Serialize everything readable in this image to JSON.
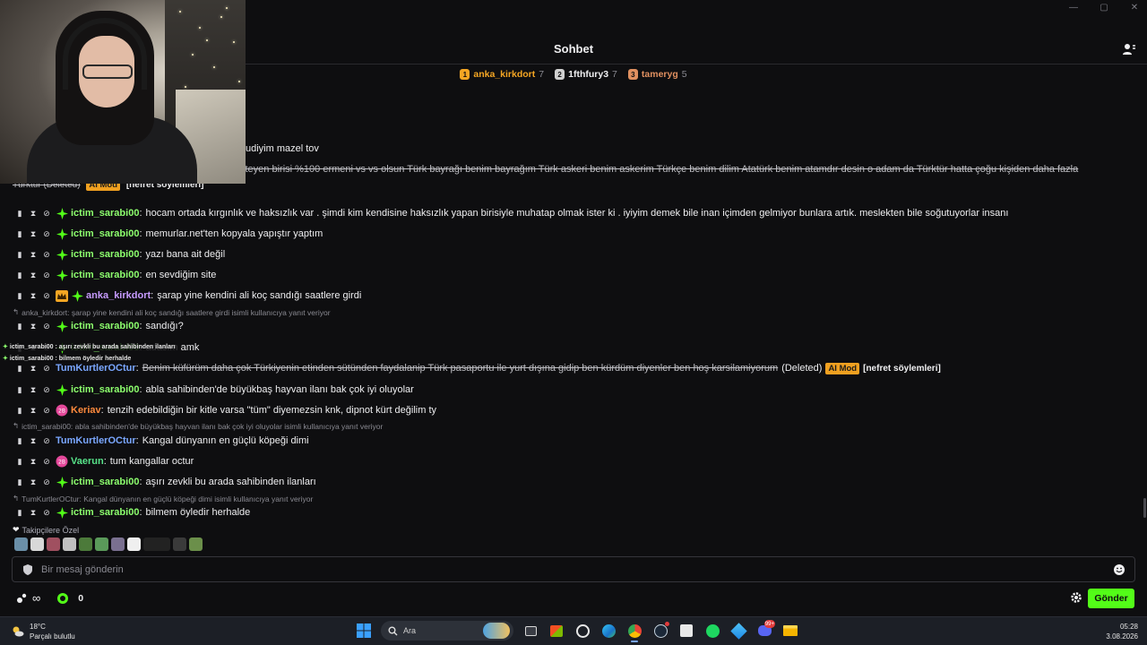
{
  "window": {
    "controls": [
      "—",
      "▢",
      "✕"
    ]
  },
  "chat": {
    "title": "Sohbet",
    "leaderboard": [
      {
        "name": "anka_kirkdort",
        "score": "7",
        "color": "#f5a623",
        "badge": "1"
      },
      {
        "name": "1fthfury3",
        "score": "7",
        "color": "#d0d0d0",
        "badge": "2"
      },
      {
        "name": "tameryg",
        "score": "5",
        "color": "#e09060",
        "badge": "3"
      }
    ],
    "partial_lines": {
      "line1": "udiyim mazel tov",
      "line2": "steyen birisi %100 ermeni vs vs olsun Türk bayrağı benim bayrağım Türk askeri benim askerim Türkçe benim dilim Atatürk benim atamdır desin o adam da Türktür hatta çoğu kişiden daha fazla",
      "line3_text": "Türktür (Deleted)",
      "line3_aimod": "AI Mod",
      "line3_reason": "[nefret söylemleri]"
    },
    "messages": [
      {
        "user": "ictim_sarabi00",
        "color": "#8dff6e",
        "text": "hocam ortada kırgınlık ve haksızlık var . şimdi kim kendisine haksızlık yapan birisiyle muhatap olmak ister ki . iyiyim demek bile inan içimden gelmiyor bunlara artık. meslekten bile soğutuyorlar insanı"
      },
      {
        "user": "ictim_sarabi00",
        "color": "#8dff6e",
        "text": "memurlar.net'ten kopyala yapıştır yaptım"
      },
      {
        "user": "ictim_sarabi00",
        "color": "#8dff6e",
        "text": "yazı bana ait değil"
      },
      {
        "user": "ictim_sarabi00",
        "color": "#8dff6e",
        "text": "en sevdiğim site"
      },
      {
        "user": "anka_kirkdort",
        "color": "#c79bff",
        "text": "şarap yine kendini ali koç sandığı saatlere girdi"
      },
      {
        "reply": "anka_kirkdort: şarap yine kendini ali koç sandığı saatlere girdi isimli kullanıcıya yanıt veriyor",
        "user": "ictim_sarabi00",
        "color": "#8dff6e",
        "text": "sandığı?"
      },
      {
        "user": "ictim_sarabi00",
        "color": "#8dff6e",
        "text": "adasım amk"
      },
      {
        "user": "TumKurtlerOCtur",
        "color": "#7aa7ff",
        "text": "Benim küfürüm daha çok Türkiyenin etinden sütünden faydalanip Türk pasaportu ile yurt dışına gidip ben kürdüm diyenler ben hoş karsilamiyorum",
        "deleted": "(Deleted)",
        "aimod": "AI Mod",
        "reason": "[nefret söylemleri]"
      },
      {
        "user": "ictim_sarabi00",
        "color": "#8dff6e",
        "text": "abla sahibinden'de büyükbaş hayvan ilanı bak çok iyi oluyolar"
      },
      {
        "user": "Keriav",
        "color": "#ff8a3d",
        "text": "tenzih edebildiğin bir kitle varsa \"tüm\" diyemezsin knk, dipnot kürt değilim ty"
      },
      {
        "reply": "ictim_sarabi00: abla sahibinden'de büyükbaş hayvan ilanı bak çok iyi oluyolar isimli kullanıcıya yanıt veriyor",
        "user": "TumKurtlerOCtur",
        "color": "#7aa7ff",
        "text": "Kangal dünyanın en güçlü köpeği dimi"
      },
      {
        "user": "Vaerun",
        "color": "#57e389",
        "text": "tum kangallar octur"
      },
      {
        "user": "ictim_sarabi00",
        "color": "#8dff6e",
        "text": "aşırı zevkli bu arada sahibinden ilanları"
      },
      {
        "reply": "TumKurtlerOCtur: Kangal dünyanın en güçlü köpeği dimi isimli kullanıcıya yanıt veriyor",
        "user": "ictim_sarabi00",
        "color": "#8dff6e",
        "text": "bilmem öyledir herhalde"
      }
    ],
    "overlay_notifs": [
      "ictim_sarabi00 : aşırı zevkli bu arada sahibinden ilanları",
      "ictim_sarabi00 : bilmem öyledir herhalde"
    ],
    "followers_label": "Takipçilere Özel",
    "input_placeholder": "Bir mesaj gönderin",
    "points": {
      "infinity": "∞",
      "count": "0"
    },
    "send_label": "Gönder",
    "accent": "#53fc18"
  },
  "taskbar": {
    "weather": {
      "temp": "18°C",
      "desc": "Parçalı bulutlu"
    },
    "search_label": "Ara",
    "time": "05:28",
    "date": "3.08.2026",
    "discord_badge": "99+"
  }
}
